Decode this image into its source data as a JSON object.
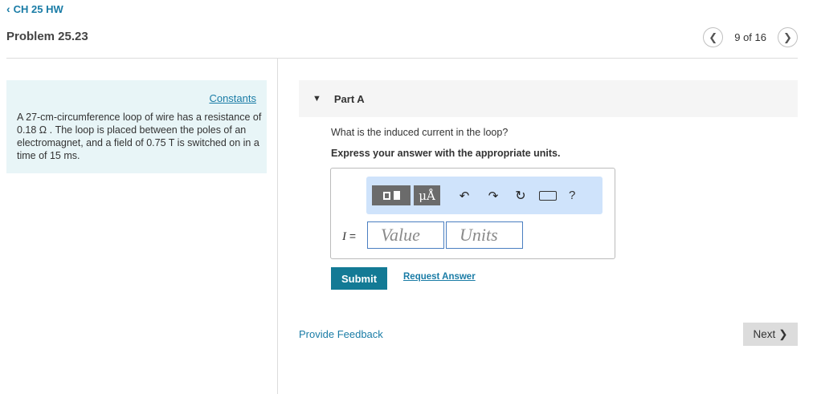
{
  "nav": {
    "back_icon": "chevron-left-icon",
    "back_label": "CH 25 HW"
  },
  "header": {
    "problem_title": "Problem 25.23",
    "pager": {
      "prev_icon": "chevron-left-icon",
      "count": "9 of 16",
      "next_icon": "chevron-right-icon"
    }
  },
  "info": {
    "constants_label": "Constants",
    "problem_text": "A 27-cm-circumference loop of wire has a resistance of 0.18  Ω . The loop is placed between the poles of an electromagnet, and a field of 0.75  T is switched on in a time of 15 ms."
  },
  "part": {
    "caret_icon": "caret-down-icon",
    "label": "Part A",
    "question": "What is the induced current in the loop?",
    "instruction": "Express your answer with the appropriate units."
  },
  "toolbar": {
    "units_label": "μÅ",
    "undo_icon": "undo-icon",
    "redo_icon": "redo-icon",
    "reset_icon": "reset-icon",
    "keyboard_icon": "keyboard-icon",
    "help_label": "?"
  },
  "answer": {
    "variable_label": "I",
    "equals": "=",
    "value_placeholder": "Value",
    "units_placeholder": "Units"
  },
  "actions": {
    "submit_label": "Submit",
    "request_answer_label": "Request Answer",
    "feedback_label": "Provide Feedback",
    "next_label": "Next"
  },
  "colors": {
    "link": "#1a7ca6",
    "submit_bg": "#137a95",
    "info_bg": "#e8f5f7",
    "toolbar_bg": "#cfe3fb",
    "field_border": "#4a7ec1"
  }
}
